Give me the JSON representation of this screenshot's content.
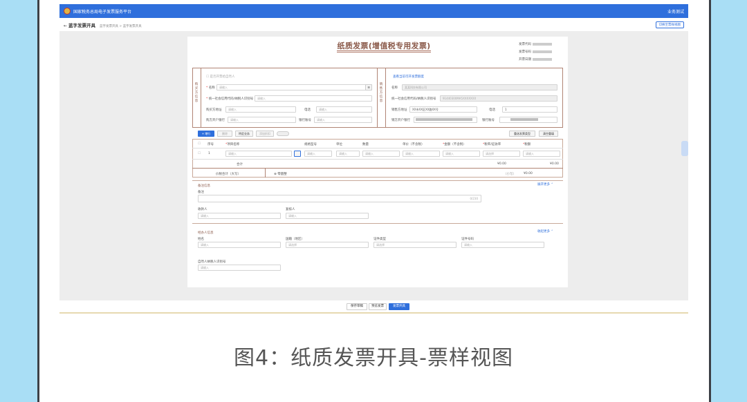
{
  "topbar": {
    "title": "国家税务总局电子发票服务平台",
    "user": "业务测试"
  },
  "subheader": {
    "title": "蓝字发票开具",
    "crumb": "蓝字发票开具 > 蓝字发票开具",
    "right_button": "切换至票样视图"
  },
  "invoice": {
    "title": "纸质发票(增值税专用发票)",
    "meta": [
      "发票代码",
      "发票号码",
      "开票日期"
    ],
    "buyer_label": "购买方信息",
    "seller_label": "销售方信息",
    "buyer": {
      "checkbox": "是否开票给自然人",
      "name_label": "名称",
      "name_ph": "请输入",
      "taxid_label": "统一社会信用代码/纳税人识别号",
      "taxid_ph": "请输入",
      "addr_label": "购买方地址",
      "addr_ph": "请输入",
      "phone_label": "电话",
      "phone_ph": "请输入",
      "bank_label": "购方开户银行",
      "bank_ph": "请输入",
      "account_label": "银行账号",
      "account_ph": "请输入"
    },
    "seller": {
      "link": "查看当前可开发票额度",
      "name_label": "名称",
      "name_ph": "某某科技有限公司",
      "taxid_label": "统一社会信用代码/纳税人识别号",
      "taxid_ph": "91440300MA5XXXXXXX",
      "addr_label": "销售方地址",
      "addr_val": "XX市XX区XX路XX号",
      "phone_label": "电话",
      "phone_val": "1",
      "bank_label": "销方开户银行",
      "account_label": "银行账号"
    },
    "toolbar": {
      "add": "+ 增行",
      "delete": "删除",
      "special": "特定业务",
      "discount": "添加折扣",
      "toggle": "",
      "import": "重选发票类型",
      "tax_calc": "清空重填"
    },
    "table": {
      "headers": [
        "序号",
        "项目名称",
        "规格型号",
        "单位",
        "数量",
        "单价（不含税）",
        "金额（不含税）",
        "税率/征收率",
        "税额"
      ],
      "row": [
        "1",
        "请输入",
        "请输入",
        "请输入",
        "请输入",
        "请输入",
        "请输入",
        "请选择",
        "请输入"
      ],
      "total_label": "合计",
      "total_amount": "¥0.00",
      "total_tax": "¥0.00",
      "price_tax_label": "价税合计（大写）",
      "price_tax_value": "零圆整",
      "small_label": "（小写）",
      "small_value": "¥0.00"
    },
    "remark": {
      "section": "备注信息",
      "toggle": "展开更多 ⌃",
      "label": "备注",
      "counter": "0/230",
      "payee_label": "收款人",
      "payee_ph": "请输入",
      "checker_label": "复核人",
      "checker_ph": "请输入"
    },
    "agent": {
      "section": "经办人信息",
      "toggle": "收起更多 ⌃",
      "name_label": "姓名",
      "name_ph": "请输入",
      "country_label": "国籍（地区）",
      "country_ph": "请选择",
      "idtype_label": "证件类型",
      "idtype_ph": "请选择",
      "idno_label": "证件号码",
      "idno_ph": "请输入",
      "taxid_label": "自然人纳税人识别号",
      "taxid_ph": "请输入"
    }
  },
  "bottom": {
    "save": "保存草稿",
    "preview": "预览发票",
    "issue": "发票开具"
  },
  "caption": "图4：纸质发票开具-票样视图"
}
